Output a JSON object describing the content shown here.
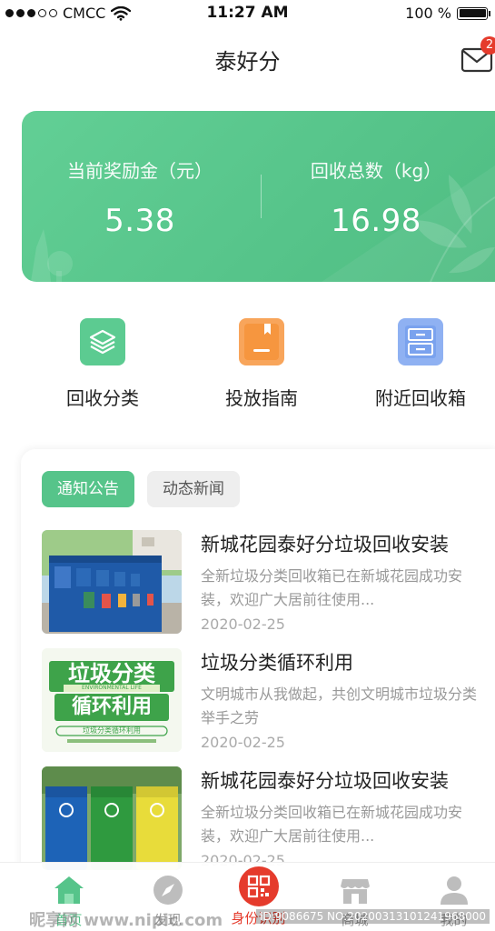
{
  "status_bar": {
    "carrier": "CMCC",
    "time": "11:27 AM",
    "battery": "100 %"
  },
  "header": {
    "title": "泰好分",
    "mail_badge": "2"
  },
  "summary": {
    "reward_label": "当前奖励金（元）",
    "reward_value": "5.38",
    "recycle_label": "回收总数（kg）",
    "recycle_value": "16.98"
  },
  "quick_actions": [
    {
      "label": "回收分类",
      "icon": "layers-icon",
      "color": "#5ccb91"
    },
    {
      "label": "投放指南",
      "icon": "book-icon",
      "color": "#f8a55b"
    },
    {
      "label": "附近回收箱",
      "icon": "cabinet-icon",
      "color": "#8fb1f2"
    }
  ],
  "news": {
    "tabs": [
      "通知公告",
      "动态新闻"
    ],
    "items": [
      {
        "title": "新城花园泰好分垃圾回收安装",
        "desc": "全新垃圾分类回收箱已在新城花园成功安装，欢迎广大居前往使用...",
        "date": "2020-02-25"
      },
      {
        "title": "垃圾分类循环利用",
        "desc": "文明城市从我做起，共创文明城市垃圾分类举手之劳",
        "date": "2020-02-25"
      },
      {
        "title": "新城花园泰好分垃圾回收安装",
        "desc": "全新垃圾分类回收箱已在新城花园成功安装，欢迎广大居前往使用...",
        "date": "2020-02-25"
      }
    ],
    "banner_text": {
      "main": "垃圾分类",
      "sub_en": "ENVIRONMENTAL LIFE",
      "line2": "循环利用",
      "line3": "垃圾分类循环利用"
    }
  },
  "tab_bar": [
    {
      "label": "首页",
      "icon": "home-icon"
    },
    {
      "label": "发现",
      "icon": "compass-icon"
    },
    {
      "label": "身份识别",
      "icon": "qr-code-icon"
    },
    {
      "label": "商城",
      "icon": "shop-icon"
    },
    {
      "label": "我的",
      "icon": "user-icon"
    }
  ],
  "watermark": {
    "left": "昵享网 www.nipic.com",
    "right": "ID:9086675 NO:20200313101241968000"
  },
  "colors": {
    "accent": "#56c48a",
    "red": "#e53b2c"
  }
}
